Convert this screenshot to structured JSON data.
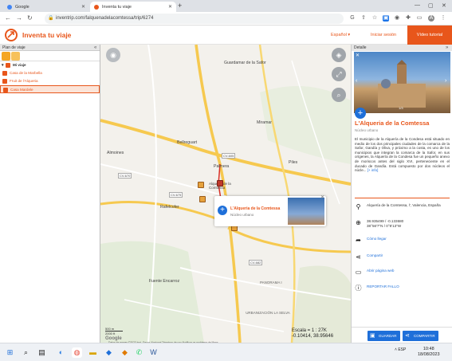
{
  "browser": {
    "tabs": [
      {
        "title": "Google",
        "active": false
      },
      {
        "title": "Inventa tu viaje",
        "active": true
      }
    ],
    "new_tab": "+",
    "url": "inventrip.com/falquenadelacomtessa/trip/6274"
  },
  "header": {
    "brand": "Inventa tu viaje",
    "language": "Español",
    "login": "Iniciar sesión",
    "video": "Vídeo tutorial"
  },
  "left_panel": {
    "title": "Plan de viaje",
    "root": "Mi viaje",
    "items": [
      {
        "label": "Casa de la Marbella"
      },
      {
        "label": "Fruit de l'Alqueria"
      },
      {
        "label": "Casa Mardele"
      }
    ]
  },
  "map": {
    "labels": [
      "Guardamar de la Safor",
      "Miramar",
      "Bellreguart",
      "Almoines",
      "Palmera",
      "Piles",
      "Rafelcofer",
      "Alquería de la Comtessa",
      "Fuente Encarroz",
      "PANORAMA I",
      "URBANIZACIÓN LA SELVA",
      "CV-670",
      "CV-675",
      "CV-605",
      "CV-682",
      "CV-60"
    ],
    "popup": {
      "title": "L'Alqueria de la Comtessa",
      "subtitle": "Núcleo urbano"
    },
    "scale_text": "Escala = 1 : 27K",
    "coordinates": "-0.10414, 38.95646",
    "scalebar_top": "500 m",
    "scalebar_bottom": "2000 ft",
    "attribution": "Datos de mapas ©2023 Inst. Geogr. Nacional    Términos de uso    Notificar un problema de Maps",
    "google": "Google"
  },
  "details": {
    "panel_title": "Detalle",
    "photo_counter": "1/3",
    "title": "L'Alqueria de la Comtessa",
    "subtitle": "Núcleo urbano",
    "description": "El municipio de la Alquería de la Condesa está situado en medio de los dos principales ciudades de la comarca de la Safor, Gandía y Oliva, y próximo a la costa, es uno de los municipios que integran la comarca de la Safor, en sus orígenes, la Alquería de la Condesa fue un pequeño anexo de moriscos antes del siglo XVI, perteneciente en el ducado de Gandía. Está compuesto por dos núcleos el núcle...",
    "more_link": "[+ info]",
    "address": "Alquería de la Comtessa, l', Valencia, España",
    "coords": "38.935499 / -0.133680",
    "coords_dms": "38°56'7\"N / 0°8'13\"W",
    "how_to_get": "Cómo llegar",
    "share": "Compartir",
    "open_web": "Abrir página web",
    "report": "REPORTAR FALLO",
    "save_btn": "GUARDAR",
    "share_btn": "COMPARTIR"
  },
  "taskbar": {
    "lang": "ESP",
    "time": "10:48",
    "date": "18/08/2023"
  },
  "colors": {
    "accent": "#e8561b",
    "link": "#1e6fd9",
    "map_road": "#f6c94f"
  }
}
